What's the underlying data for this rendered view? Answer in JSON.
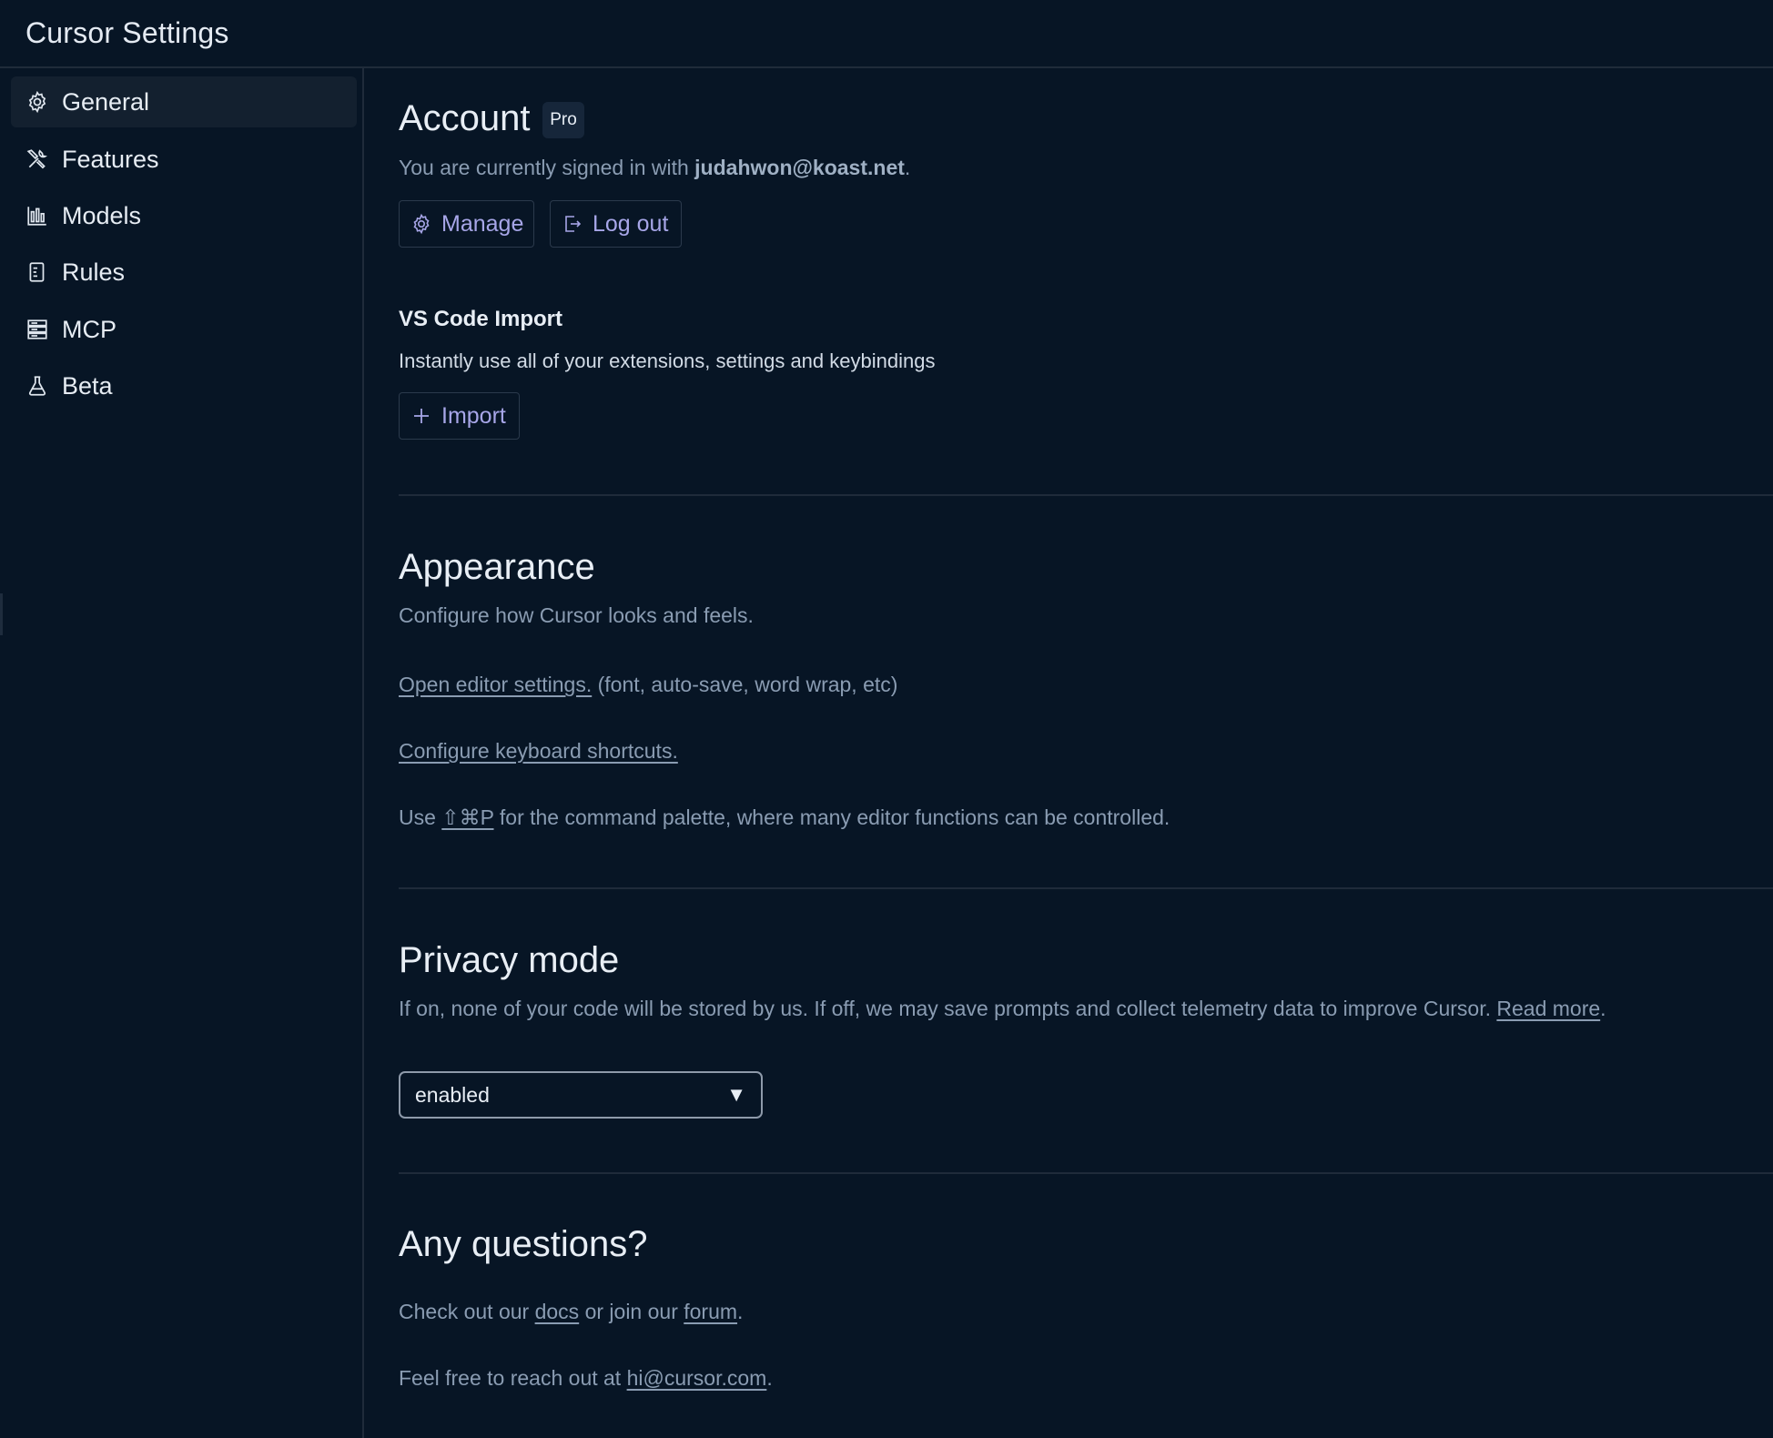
{
  "window": {
    "title": "Cursor Settings"
  },
  "sidebar": {
    "items": [
      {
        "label": "General",
        "icon": "gear-icon",
        "active": true
      },
      {
        "label": "Features",
        "icon": "tools-icon",
        "active": false
      },
      {
        "label": "Models",
        "icon": "bar-chart-icon",
        "active": false
      },
      {
        "label": "Rules",
        "icon": "document-icon",
        "active": false
      },
      {
        "label": "MCP",
        "icon": "server-icon",
        "active": false
      },
      {
        "label": "Beta",
        "icon": "flask-icon",
        "active": false
      }
    ]
  },
  "account": {
    "heading": "Account",
    "badge": "Pro",
    "signed_in_prefix": "You are currently signed in with ",
    "email": "judahwon@koast.net",
    "signed_in_suffix": ".",
    "manage_label": "Manage",
    "logout_label": "Log out"
  },
  "vscode_import": {
    "heading": "VS Code Import",
    "description": "Instantly use all of your extensions, settings and keybindings",
    "import_label": "Import"
  },
  "appearance": {
    "heading": "Appearance",
    "description": "Configure how Cursor looks and feels.",
    "editor_settings_link": "Open editor settings.",
    "editor_settings_hint": " (font, auto-save, word wrap, etc)",
    "keyboard_shortcuts_link": "Configure keyboard shortcuts.",
    "palette_prefix": "Use ",
    "palette_shortcut": "⇧⌘P",
    "palette_suffix": " for the command palette, where many editor functions can be controlled."
  },
  "privacy": {
    "heading": "Privacy mode",
    "description": "If on, none of your code will be stored by us. If off, we may save prompts and collect telemetry data to improve Cursor. ",
    "read_more_link": "Read more",
    "description_end": ".",
    "selected_value": "enabled",
    "arrow": "▼"
  },
  "questions": {
    "heading": "Any questions?",
    "line1_prefix": "Check out our ",
    "docs_link": "docs",
    "line1_middle": " or join our ",
    "forum_link": "forum",
    "line1_suffix": ".",
    "line2_prefix": "Feel free to reach out at ",
    "email_link": "hi@cursor.com",
    "line2_suffix": "."
  },
  "colors": {
    "background": "#071525",
    "active_nav": "#13202f",
    "accent_button_text": "#a7a6e8",
    "muted_text": "#8a9cb2"
  }
}
